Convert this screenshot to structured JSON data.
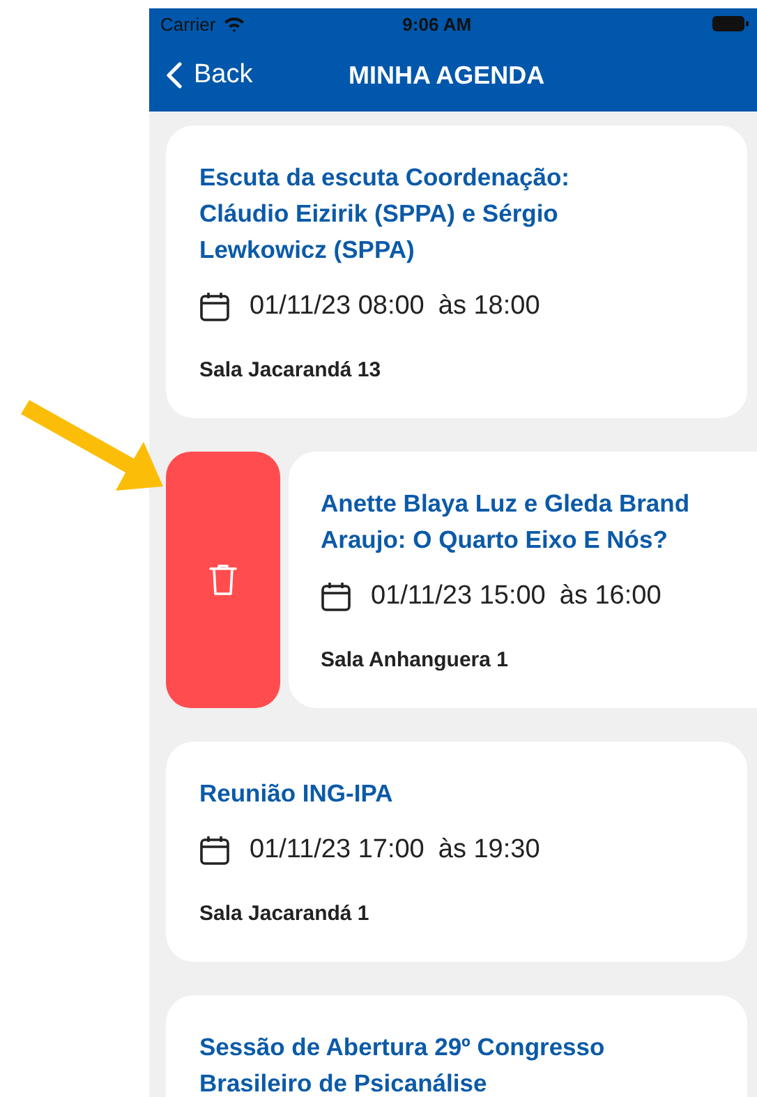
{
  "status_bar": {
    "carrier": "Carrier",
    "time": "9:06 AM"
  },
  "nav": {
    "back": "Back",
    "title": "MINHA AGENDA"
  },
  "events": [
    {
      "title_lines": [
        "Escuta da escuta Coordenação:",
        "Cláudio Eizirik (SPPA) e Sérgio",
        "Lewkowicz (SPPA)"
      ],
      "date": "01/11/23 08:00",
      "end": "às 18:00",
      "room": "Sala Jacarandá 13",
      "swiped": false
    },
    {
      "title_lines": [
        "Anette Blaya Luz e Gleda Brand",
        "Araujo: O Quarto Eixo E Nós?"
      ],
      "date": "01/11/23 15:00",
      "end": "às 16:00",
      "room": "Sala Anhanguera 1",
      "swiped": true
    },
    {
      "title_lines": [
        "Reunião ING-IPA"
      ],
      "date": "01/11/23 17:00",
      "end": "às 19:30",
      "room": "Sala Jacarandá 1",
      "swiped": false
    },
    {
      "title_lines": [
        "Sessão de Abertura 29º Congresso",
        "Brasileiro de Psicanálise"
      ],
      "swiped": false
    }
  ]
}
